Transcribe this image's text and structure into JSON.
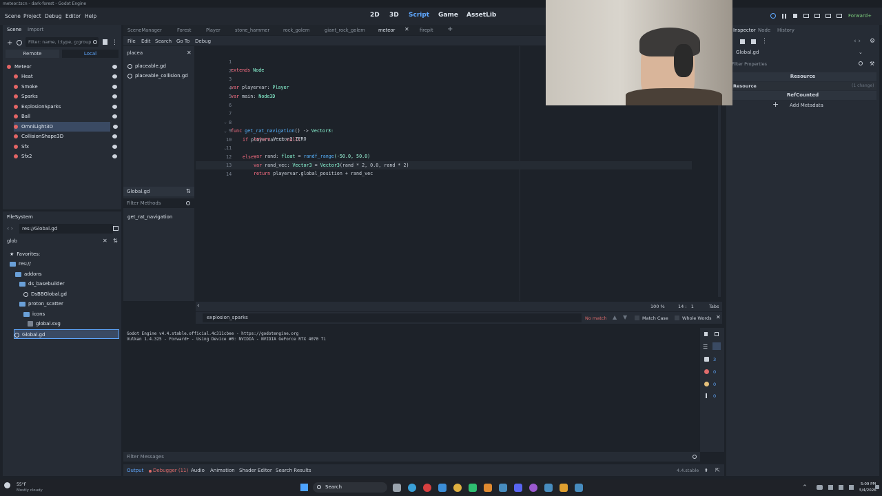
{
  "window": {
    "title": "meteor.tscn - dark-forest - Godot Engine"
  },
  "menu": [
    "Scene",
    "Project",
    "Debug",
    "Editor",
    "Help"
  ],
  "workspaces": [
    "2D",
    "3D",
    "Script",
    "Game",
    "AssetLib"
  ],
  "renderer": "Forward+",
  "scene_dock": {
    "tabs": [
      "Scene",
      "Import"
    ],
    "filter_placeholder": "Filter: name, t:type, g:group",
    "remote": "Remote",
    "local": "Local",
    "nodes": [
      "Meteor",
      "Heat",
      "Smoke",
      "Sparks",
      "ExplosionSparks",
      "Ball",
      "OmniLight3D",
      "CollisionShape3D",
      "Sfx",
      "Sfx2"
    ]
  },
  "filesystem": {
    "title": "FileSystem",
    "path": "res://Global.gd",
    "search": "glob",
    "items": [
      "Favorites:",
      "res://",
      "addons",
      "ds_basebuilder",
      "DsBBGlobal.gd",
      "proton_scatter",
      "icons",
      "global.svg",
      "Global.gd"
    ]
  },
  "script_tabs": [
    "SceneManager",
    "Forest",
    "Player",
    "stone_hammer",
    "rock_golem",
    "giant_rock_golem",
    "meteor",
    "firepit"
  ],
  "script_menu": [
    "File",
    "Edit",
    "Search",
    "Go To",
    "Debug"
  ],
  "script_list": {
    "filter": "placea",
    "files": [
      "placeable.gd",
      "placeable_collision.gd"
    ],
    "current": "Global.gd",
    "filter_methods": "Filter Methods",
    "methods": [
      "get_rat_navigation"
    ]
  },
  "code": {
    "line_numbers": [
      "1",
      "2",
      "3",
      "4",
      "5",
      "6",
      "7",
      "8",
      "9",
      "10",
      "11",
      "12",
      "13",
      "14"
    ],
    "l1a": "extends",
    "l1b": "Node",
    "l3a": "var",
    "l3b": "playervar:",
    "l3c": "Player",
    "l4a": "var",
    "l4b": "main:",
    "l4c": "Node3D",
    "l7a": "func",
    "l7b": "get_rat_navigation",
    "l7c": "() ->",
    "l7d": "Vector3:",
    "l8a": "if",
    "l8b": "playervar ==",
    "l8c": "null:",
    "l9a": "return",
    "l9b": "Vector3.ZERO",
    "l10a": "else:",
    "l11a": "var",
    "l11b": "rand:",
    "l11c": "float",
    "l11d": "=",
    "l11e": "randf_range",
    "l11f": "(-50.0, 50.0)",
    "l12a": "var",
    "l12b": "rand_vec:",
    "l12c": "Vector3",
    "l12d": "=",
    "l12e": "Vector3",
    "l12f": "(rand * 2, 0.0, rand * 2)",
    "l13a": "return",
    "l13b": "playervar.global_position + rand_vec"
  },
  "status": {
    "zoom": "100 %",
    "pos": "14 :   1",
    "indent": "Tabs"
  },
  "find_bar": {
    "text": "explosion_sparks",
    "result": "No match",
    "match_case": "Match Case",
    "whole_words": "Whole Words"
  },
  "output": {
    "lines": [
      "Godot Engine v4.4.stable.official.4c311cbee - https://godotengine.org",
      "Vulkan 1.4.325 - Forward+ - Using Device #0: NVIDIA - NVIDIA GeForce RTX 4070 Ti"
    ],
    "filter": "Filter Messages",
    "counts": [
      "3",
      "0",
      "0",
      "0"
    ],
    "version": "4.4.stable"
  },
  "bottom_tabs": [
    "Output",
    "Debugger (11)",
    "Audio",
    "Animation",
    "Shader Editor",
    "Search Results"
  ],
  "inspector": {
    "tabs": [
      "Inspector",
      "Node",
      "History"
    ],
    "resource": "Global.gd",
    "filter": "Filter Properties",
    "section": "Resource",
    "sub": "Resource",
    "changes": "(1 change)",
    "refcounted": "RefCounted",
    "add_metadata": "Add Metadata"
  },
  "taskbar": {
    "weather_temp": "55°F",
    "weather_desc": "Mostly cloudy",
    "search": "Search",
    "time": "5:09 PM",
    "date": "5/4/2026"
  },
  "colors": {
    "accent": "#5fa8ff",
    "bg": "#1d2229",
    "panel": "#262c35",
    "selection": "#3a4a63"
  }
}
